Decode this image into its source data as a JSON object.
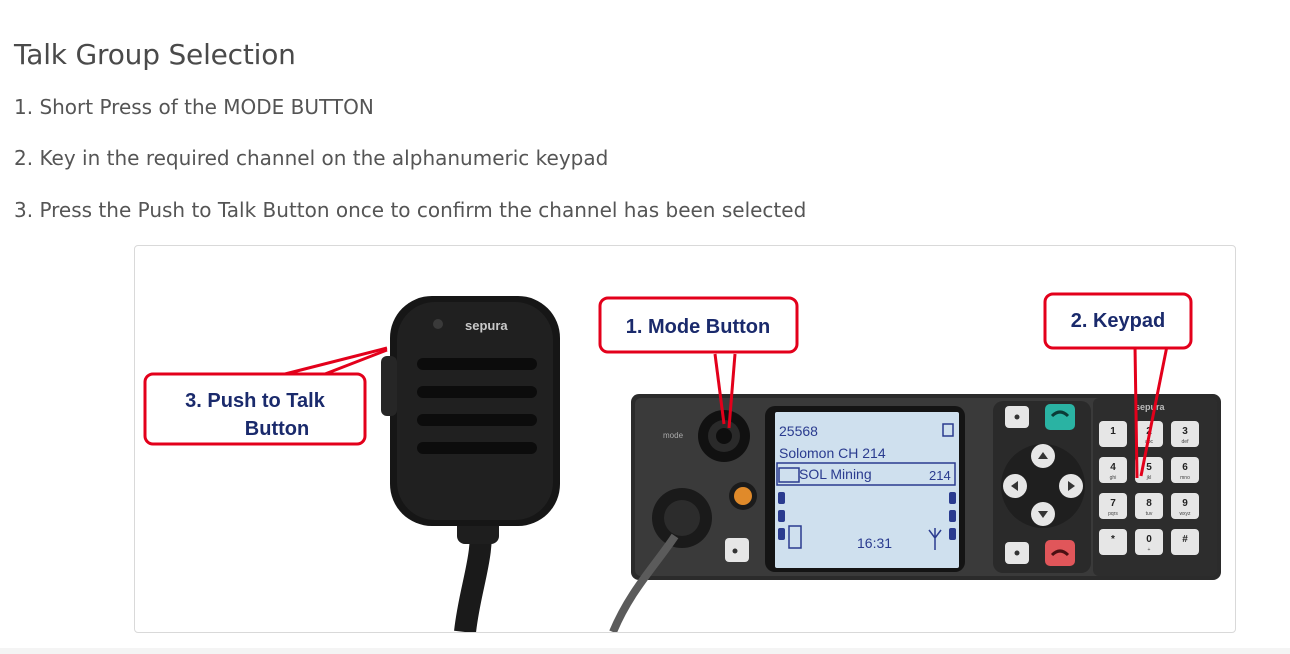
{
  "heading": "Talk Group Selection",
  "steps": [
    "1. Short Press of the MODE BUTTON",
    "2. Key in the required channel on the alphanumeric keypad",
    "3. Press the Push to Talk Button once to confirm the channel has been selected"
  ],
  "callouts": {
    "mode": "1. Mode Button",
    "keypad": "2. Keypad",
    "ptt_line1": "3. Push to Talk",
    "ptt_line2": "Button"
  },
  "device": {
    "brand_mic": "sepura",
    "brand_radio": "sepura",
    "mode_label": "mode",
    "screen": {
      "line1": "25568",
      "line2": "Solomon CH 214",
      "line3": "SOL Mining",
      "line3_num": "214",
      "clock": "16:31"
    },
    "keys": [
      {
        "digit": "1",
        "letters": ""
      },
      {
        "digit": "2",
        "letters": "abc"
      },
      {
        "digit": "3",
        "letters": "def"
      },
      {
        "digit": "4",
        "letters": "ghi"
      },
      {
        "digit": "5",
        "letters": "jkl"
      },
      {
        "digit": "6",
        "letters": "mno"
      },
      {
        "digit": "7",
        "letters": "pqrs"
      },
      {
        "digit": "8",
        "letters": "tuv"
      },
      {
        "digit": "9",
        "letters": "wxyz"
      },
      {
        "digit": "*",
        "letters": ""
      },
      {
        "digit": "0",
        "letters": "+"
      },
      {
        "digit": "#",
        "letters": ""
      }
    ]
  },
  "colors": {
    "callout_border": "#e3001b",
    "callout_text": "#1a2a6c",
    "screen_bg": "#cfe0ee",
    "screen_text": "#2a3b8f",
    "green_key": "#2ab3a3",
    "red_key": "#e0565a",
    "emergency": "#e08a2a"
  }
}
